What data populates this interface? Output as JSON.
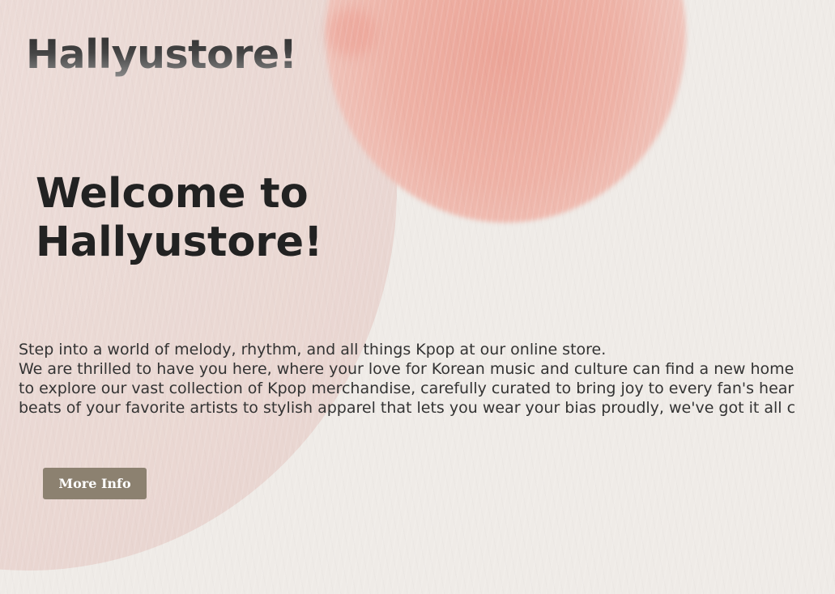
{
  "header": {
    "logo_text": "Hallyustore!"
  },
  "hero": {
    "headline": "Welcome to Hallyustore!",
    "intro_lines": [
      "Step into a world of melody, rhythm, and all things Kpop at our online store.",
      "We are thrilled to have you here, where your love for Korean music and culture can find a new home",
      "to explore our vast collection of Kpop merchandise, carefully curated to bring joy to every fan's hear",
      "beats of your favorite artists to stylish apparel that lets you wear your bias proudly, we've got it all c"
    ],
    "more_info_label": "More Info"
  },
  "colors": {
    "background": "#efebe7",
    "pink_shape": "#ead8d3",
    "coral_shape": "#eba497",
    "button": "#8c8170",
    "headline": "#222222"
  }
}
